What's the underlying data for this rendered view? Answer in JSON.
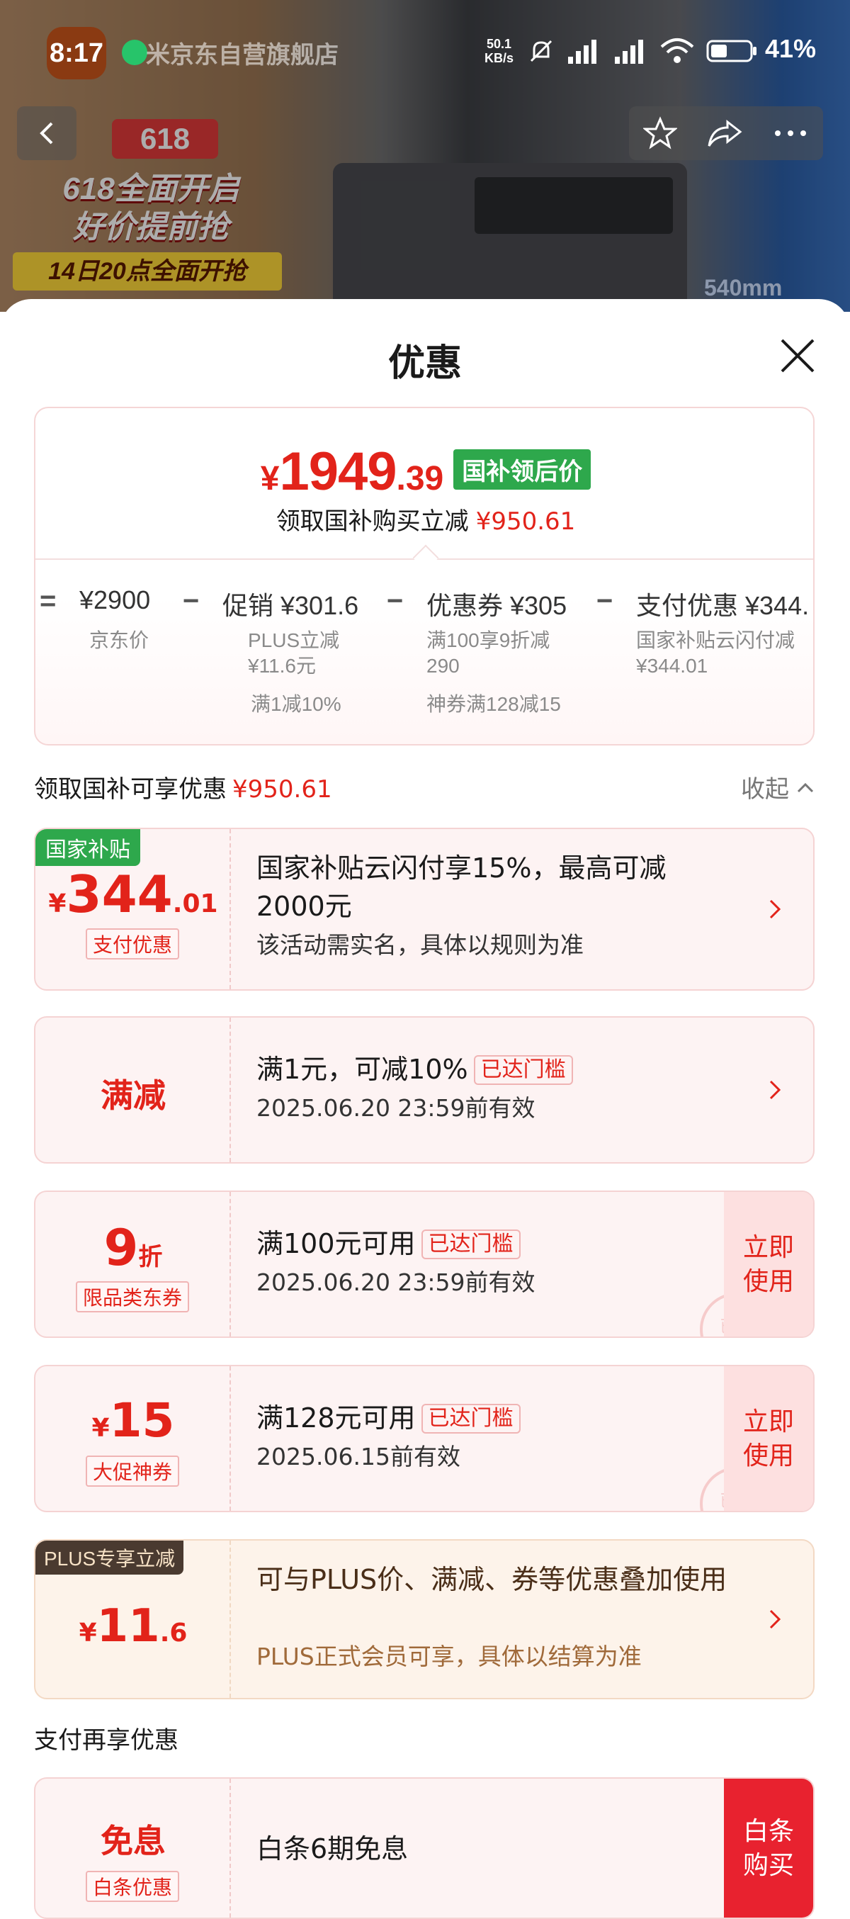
{
  "status_bar": {
    "time": "8:17",
    "shop_name": "米京东自营旗舰店",
    "net_speed_value": "50.1",
    "net_speed_unit": "KB/s",
    "battery": "41%"
  },
  "backdrop": {
    "promo_badge": "618",
    "promo_line1": "618全面开启",
    "promo_line2": "好价提前抢",
    "promo_line3": "14日20点全面开抢",
    "size_label": "540mm"
  },
  "sheet": {
    "title": "优惠",
    "summary": {
      "currency": "¥",
      "price_int": "1949",
      "price_dec": ".39",
      "price_tag": "国补领后价",
      "save_label": "领取国补购买立减",
      "save_amount": "¥950.61",
      "calc": [
        {
          "op": "=",
          "head": "¥2900",
          "subs": [
            "京东价"
          ]
        },
        {
          "op": "−",
          "head": "促销 ¥301.6",
          "subs": [
            "PLUS立减\n¥11.6元",
            "满1减10%"
          ]
        },
        {
          "op": "−",
          "head": "优惠券 ¥305",
          "subs": [
            "满100享9折减\n290",
            "神券满128减15"
          ]
        },
        {
          "op": "−",
          "head": "支付优惠 ¥344.",
          "subs": [
            "国家补贴云闪付减\n¥344.01"
          ]
        }
      ]
    },
    "section_label": "领取国补可享优惠",
    "section_amount": "¥950.61",
    "collapse_label": "收起",
    "offers": [
      {
        "corner_tag": "国家补贴",
        "amount_int": "344",
        "amount_dec": ".01",
        "tag": "支付优惠",
        "title": "国家补贴云闪付享15%，最高可减2000元",
        "desc": "该活动需实名，具体以规则为准"
      },
      {
        "amount_text": "满减",
        "title": "满1元，可减10%",
        "threshold": "已达门槛",
        "desc": "2025.06.20 23:59前有效"
      },
      {
        "amount_int": "9",
        "amount_unit": "折",
        "tag": "限品类东券",
        "title": "满100元可用",
        "threshold": "已达门槛",
        "desc": "2025.06.20 23:59前有效",
        "button": "立即\n使用",
        "stamp": "已领"
      },
      {
        "amount_int": "15",
        "tag": "大促神券",
        "title": "满128元可用",
        "threshold": "已达门槛",
        "desc": "2025.06.15前有效",
        "button": "立即\n使用",
        "stamp": "已领"
      },
      {
        "corner_tag": "PLUS专享立减",
        "amount_int": "11",
        "amount_dec": ".6",
        "title": "可与PLUS价、满减、券等优惠叠加使用",
        "desc": "PLUS正式会员可享，具体以结算为准"
      }
    ],
    "pay_section_label": "支付再享优惠",
    "pay_offer": {
      "amount_text": "免息",
      "tag": "白条优惠",
      "title": "白条6期免息",
      "button": "白条\n购买"
    }
  },
  "colors": {
    "accent": "#e2231a",
    "subsidy_green": "#2ea84c",
    "plus_brown": "#4a3a30"
  }
}
